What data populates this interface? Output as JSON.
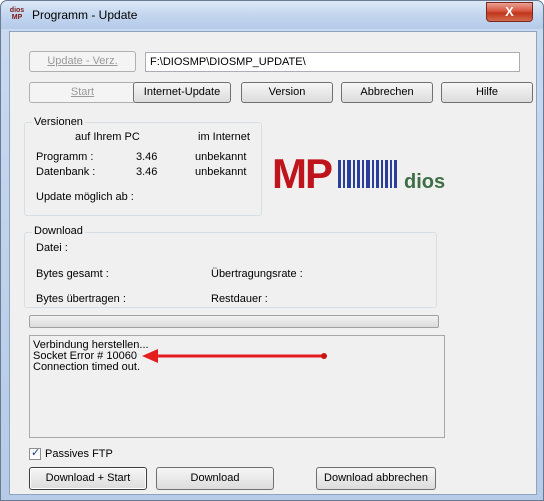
{
  "window": {
    "title": "Programm - Update",
    "icon_label_top": "dios",
    "icon_label_bottom": "MP",
    "close_glyph": "X"
  },
  "toolbar": {
    "update_dir_label": "Update - Verz.",
    "path_value": "F:\\DIOSMP\\DIOSMP_UPDATE\\",
    "start_label": "Start",
    "internet_update_label": "Internet-Update",
    "version_label": "Version",
    "cancel_label": "Abbrechen",
    "help_label": "Hilfe"
  },
  "versions": {
    "title": "Versionen",
    "col_local": "auf Ihrem PC",
    "col_internet": "im Internet",
    "rows": [
      {
        "label": "Programm :",
        "local": "3.46",
        "internet": "unbekannt"
      },
      {
        "label": "Datenbank :",
        "local": "3.46",
        "internet": "unbekannt"
      }
    ],
    "update_possible_label": "Update möglich ab :"
  },
  "logo": {
    "mp_text": "MP",
    "dios_text": "dios",
    "brand_red": "#c0141c",
    "brand_blue": "#2a3f9a",
    "brand_green": "#3f6e46"
  },
  "download": {
    "title": "Download",
    "file_label": "Datei :",
    "bytes_total_label": "Bytes gesamt :",
    "transfer_rate_label": "Übertragungsrate :",
    "bytes_transferred_label": "Bytes übertragen :",
    "remaining_label": "Restdauer :",
    "progress": 0
  },
  "log": {
    "lines": [
      "Verbindung herstellen...",
      "Socket Error # 10060",
      "Connection timed out."
    ],
    "arrow_color": "#e41e1e"
  },
  "options": {
    "passive_ftp_label": "Passives FTP",
    "passive_ftp_checked": true
  },
  "bottom_buttons": {
    "download_start_label": "Download + Start",
    "download_label": "Download",
    "download_cancel_label": "Download abbrechen"
  }
}
